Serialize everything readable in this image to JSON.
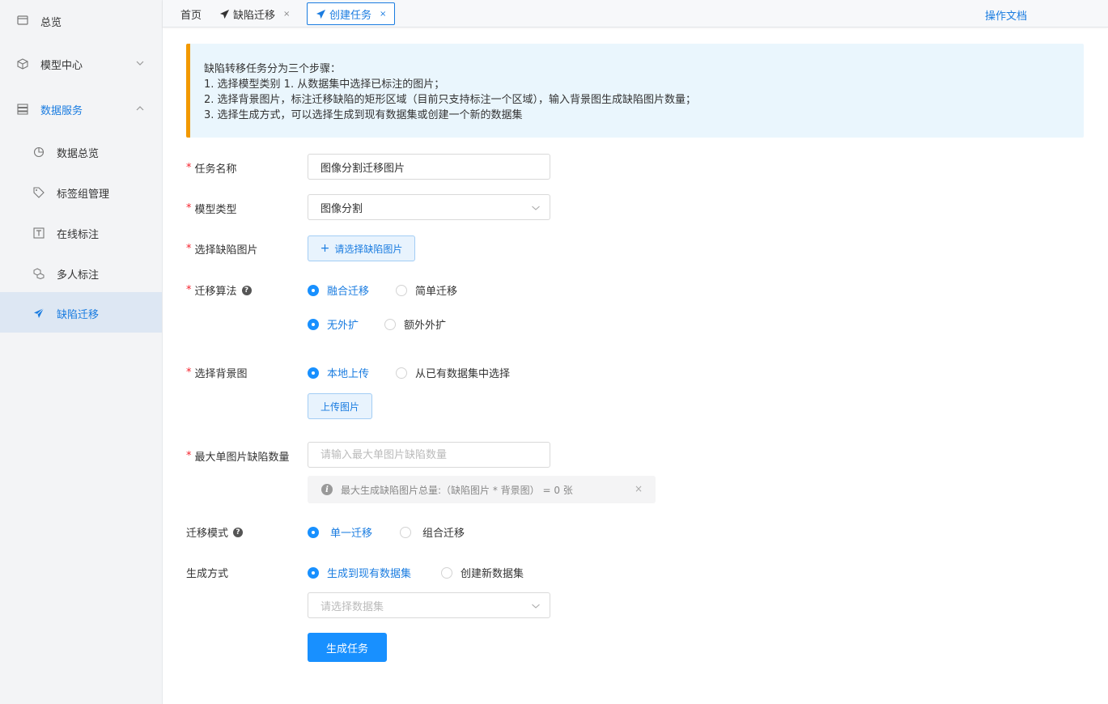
{
  "sidebar": {
    "items": [
      {
        "label": "总览",
        "icon": "overview-icon"
      },
      {
        "label": "模型中心",
        "icon": "cube-icon"
      },
      {
        "label": "数据服务",
        "icon": "database-icon"
      },
      {
        "label": "数据总览",
        "icon": "pie-chart-icon"
      },
      {
        "label": "标签组管理",
        "icon": "tag-icon"
      },
      {
        "label": "在线标注",
        "icon": "text-box-icon"
      },
      {
        "label": "多人标注",
        "icon": "multi-cube-icon"
      },
      {
        "label": "缺陷迁移",
        "icon": "paper-plane-icon"
      }
    ]
  },
  "tabs": {
    "home": "首页",
    "defect": "缺陷迁移",
    "create": "创建任务",
    "close": "×"
  },
  "header": {
    "doc_link": "操作文档"
  },
  "alert": {
    "lines": [
      "缺陷转移任务分为三个步骤：",
      "1. 选择模型类别 1. 从数据集中选择已标注的图片；",
      "2. 选择背景图片，标注迁移缺陷的矩形区域（目前只支持标注一个区域），输入背景图生成缺陷图片数量；",
      "3. 选择生成方式，可以选择生成到现有数据集或创建一个新的数据集"
    ]
  },
  "form": {
    "required_mark": "*",
    "task_name": {
      "label": "任务名称",
      "value": "图像分割迁移图片"
    },
    "model_type": {
      "label": "模型类型",
      "value": "图像分割"
    },
    "defect_image": {
      "label": "选择缺陷图片",
      "button": "请选择缺陷图片",
      "plus": "+"
    },
    "algorithm": {
      "label": "迁移算法",
      "help": "?",
      "options_row1": [
        "融合迁移",
        "简单迁移"
      ],
      "options_row2": [
        "无外扩",
        "额外外扩"
      ]
    },
    "background": {
      "label": "选择背景图",
      "options": [
        "本地上传",
        "从已有数据集中选择"
      ],
      "upload_button": "上传图片"
    },
    "max_defects": {
      "label": "最大单图片缺陷数量",
      "placeholder": "请输入最大单图片缺陷数量",
      "notice": "最大生成缺陷图片总量:（缺陷图片 * 背景图） =   0 张",
      "notice_icon": "i",
      "notice_close": "×"
    },
    "mode": {
      "label": "迁移模式",
      "help": "?",
      "options": [
        "单一迁移",
        "组合迁移"
      ]
    },
    "generate": {
      "label": "生成方式",
      "options": [
        "生成到现有数据集",
        "创建新数据集"
      ],
      "dataset_placeholder": "请选择数据集"
    },
    "submit": "生成任务"
  },
  "colors": {
    "primary": "#1890ff",
    "accent_text": "#1a7ce0",
    "alert_border": "#f29900",
    "required": "#f5222d"
  }
}
